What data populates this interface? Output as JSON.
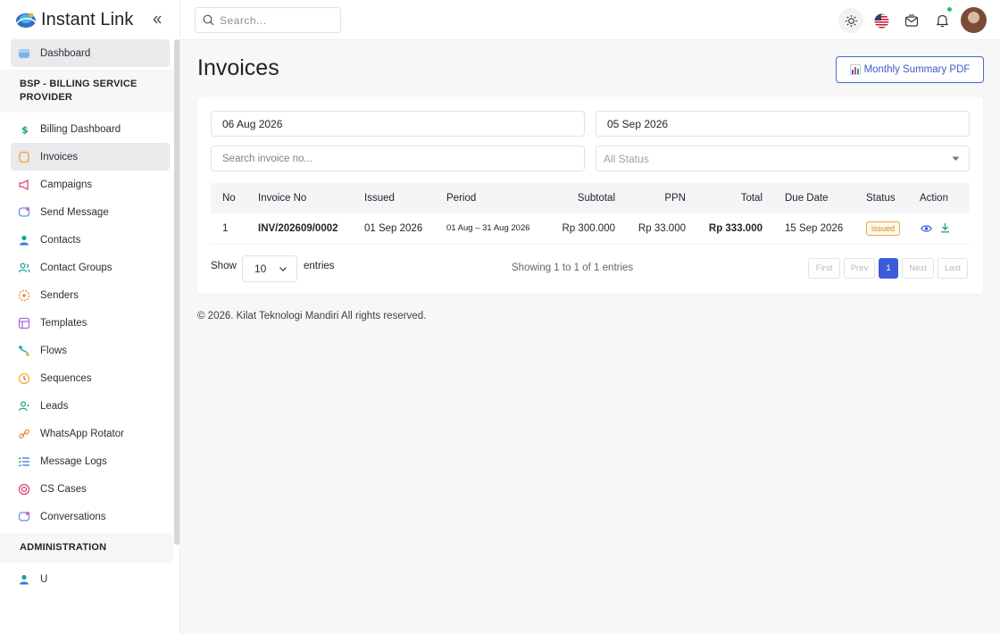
{
  "brand": {
    "name": "Instant Link"
  },
  "sidebar": {
    "dashboard": "Dashboard",
    "section_bsp": "BSP - BILLING SERVICE PROVIDER",
    "items": [
      {
        "label": "Billing Dashboard",
        "icon": "dollar-icon"
      },
      {
        "label": "Invoices",
        "icon": "invoice-icon"
      },
      {
        "label": "Campaigns",
        "icon": "megaphone-icon"
      },
      {
        "label": "Send Message",
        "icon": "message-icon"
      },
      {
        "label": "Contacts",
        "icon": "contact-icon"
      },
      {
        "label": "Contact Groups",
        "icon": "group-icon"
      },
      {
        "label": "Senders",
        "icon": "sender-icon"
      },
      {
        "label": "Templates",
        "icon": "template-icon"
      },
      {
        "label": "Flows",
        "icon": "flow-icon"
      },
      {
        "label": "Sequences",
        "icon": "sequence-icon"
      },
      {
        "label": "Leads",
        "icon": "lead-icon"
      },
      {
        "label": "WhatsApp Rotator",
        "icon": "rotator-icon"
      },
      {
        "label": "Message Logs",
        "icon": "log-icon"
      },
      {
        "label": "CS Cases",
        "icon": "case-icon"
      },
      {
        "label": "Conversations",
        "icon": "conversation-icon"
      }
    ],
    "section_admin": "ADMINISTRATION",
    "admin_partial": "U"
  },
  "topbar": {
    "search_placeholder": "Search..."
  },
  "page": {
    "title": "Invoices",
    "summary_button": "Monthly Summary PDF"
  },
  "filters": {
    "date_from": "06 Aug 2026",
    "date_to": "05 Sep 2026",
    "invoice_placeholder": "Search invoice no...",
    "status_value": "All Status"
  },
  "table": {
    "headers": [
      "No",
      "Invoice No",
      "Issued",
      "Period",
      "Subtotal",
      "PPN",
      "Total",
      "Due Date",
      "Status",
      "Action"
    ],
    "rows": [
      {
        "no": "1",
        "invoice_no": "INV/202609/0002",
        "issued": "01 Sep 2026",
        "period": "01 Aug – 31 Aug 2026",
        "subtotal": "Rp 300.000",
        "ppn": "Rp 33.000",
        "total": "Rp 333.000",
        "due_date": "15 Sep 2026",
        "status": "issued"
      }
    ]
  },
  "pagination": {
    "show_label": "Show",
    "page_length": "10",
    "entries_label": "entries",
    "info": "Showing 1 to 1 of 1 entries",
    "first": "First",
    "prev": "Prev",
    "current": "1",
    "next": "Next",
    "last": "Last"
  },
  "footer": {
    "text": "© 2026. Kilat Teknologi Mandiri All rights reserved."
  },
  "colors": {
    "accent": "#3b5bdb",
    "status_issued": "#d28a1c",
    "online": "#22c55e"
  }
}
